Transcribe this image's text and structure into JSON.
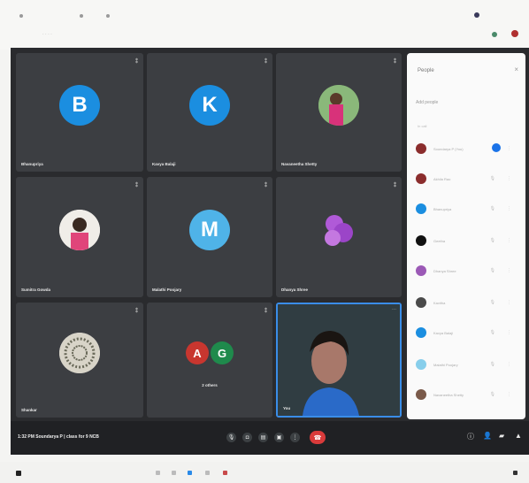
{
  "meeting": {
    "tiles": [
      {
        "name": "Bhanupriya",
        "type": "initial",
        "initial": "B",
        "color": "#1b8ee0"
      },
      {
        "name": "Kavya Balaji",
        "type": "initial",
        "initial": "K",
        "color": "#1b8ee0"
      },
      {
        "name": "Navaneetha Shetty",
        "type": "photo"
      },
      {
        "name": "Sumitra Gowda",
        "type": "photo"
      },
      {
        "name": "Malathi Poojary",
        "type": "initial",
        "initial": "M",
        "color": "#4fb3e8"
      },
      {
        "name": "Dhanya Shree",
        "type": "photo"
      },
      {
        "name": "Shankar",
        "type": "photo"
      },
      {
        "name": "2 others",
        "type": "group",
        "initials": [
          "A",
          "G"
        ],
        "colors": [
          "#c8362f",
          "#1f8a4c"
        ]
      },
      {
        "name": "You",
        "type": "self"
      }
    ]
  },
  "people_panel": {
    "title": "People",
    "add_people": "Add people",
    "section": "In call",
    "participants": [
      {
        "name": "Soundarya P (You)",
        "color": "#8b2d2d"
      },
      {
        "name": "Akhila Rao",
        "color": "#8b2d2d"
      },
      {
        "name": "Bhanupriya",
        "color": "#1b8ee0"
      },
      {
        "name": "Geetha",
        "color": "#111111"
      },
      {
        "name": "Dhanya Shree",
        "color": "#9b59b6"
      },
      {
        "name": "Kavitha",
        "color": "#4a4a4a"
      },
      {
        "name": "Kavya Balaji",
        "color": "#1b8ee0"
      },
      {
        "name": "Malathi Poojary",
        "color": "#87ceeb"
      },
      {
        "name": "Navaneetha Shetty",
        "color": "#7a5a4a"
      }
    ]
  },
  "bottom_bar": {
    "time": "1:32 PM",
    "title": "Soundarya P  |  class for 9 NCB"
  }
}
